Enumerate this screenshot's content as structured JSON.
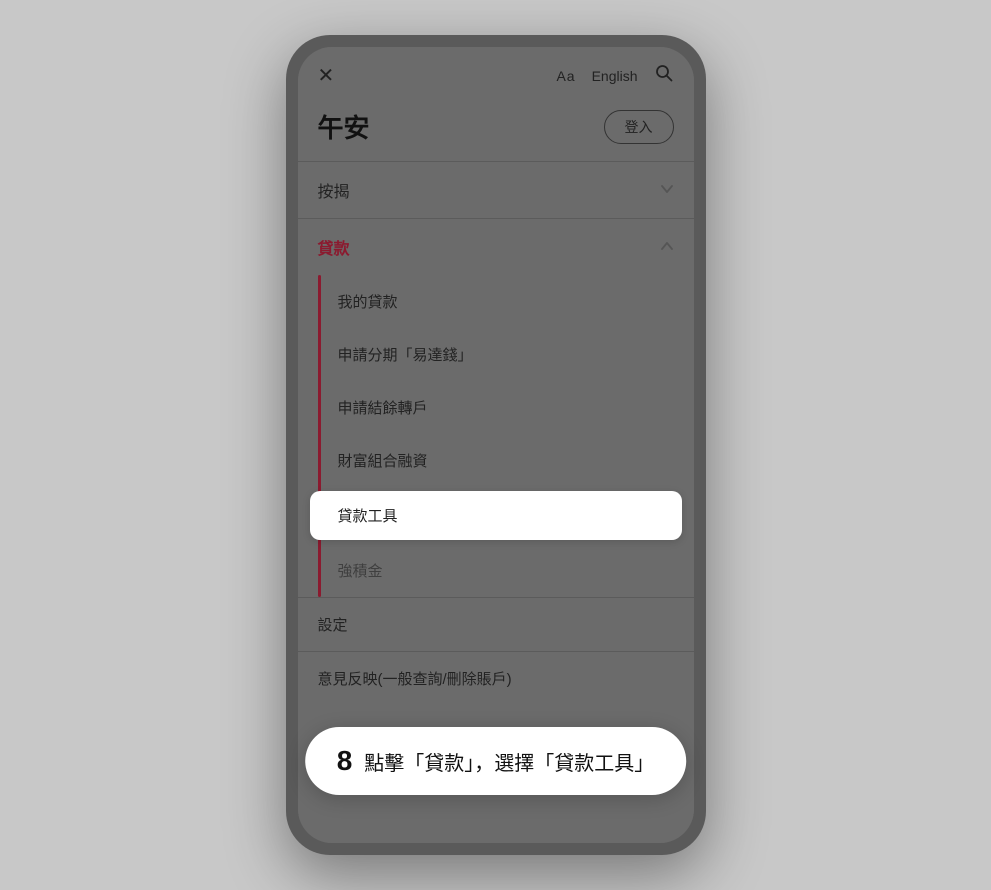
{
  "phone": {
    "nav": {
      "close_icon": "✕",
      "font_size_label": "Aa",
      "language": "English",
      "search_icon": "🔍"
    },
    "greeting": "午安",
    "login_button": "登入",
    "menu": {
      "sections": [
        {
          "id": "按揭",
          "label": "按揭",
          "expanded": false,
          "chevron": "▾"
        },
        {
          "id": "貸款",
          "label": "貸款",
          "expanded": true,
          "chevron": "▴",
          "items": [
            {
              "label": "我的貸款",
              "highlighted": false
            },
            {
              "label": "申請分期「易達錢」",
              "highlighted": false
            },
            {
              "label": "申請結餘轉戶",
              "highlighted": false
            },
            {
              "label": "財富組合融資",
              "highlighted": false
            },
            {
              "label": "貸款工具",
              "highlighted": true
            },
            {
              "label": "強積金",
              "highlighted": false
            }
          ]
        }
      ],
      "bottom_items": [
        {
          "label": "設定"
        },
        {
          "label": "意見反映(一般查詢/刪除賬戶)"
        }
      ]
    },
    "instruction": {
      "step_number": "8",
      "text": "點擊「貸款」，選擇「貸款工具」"
    }
  }
}
